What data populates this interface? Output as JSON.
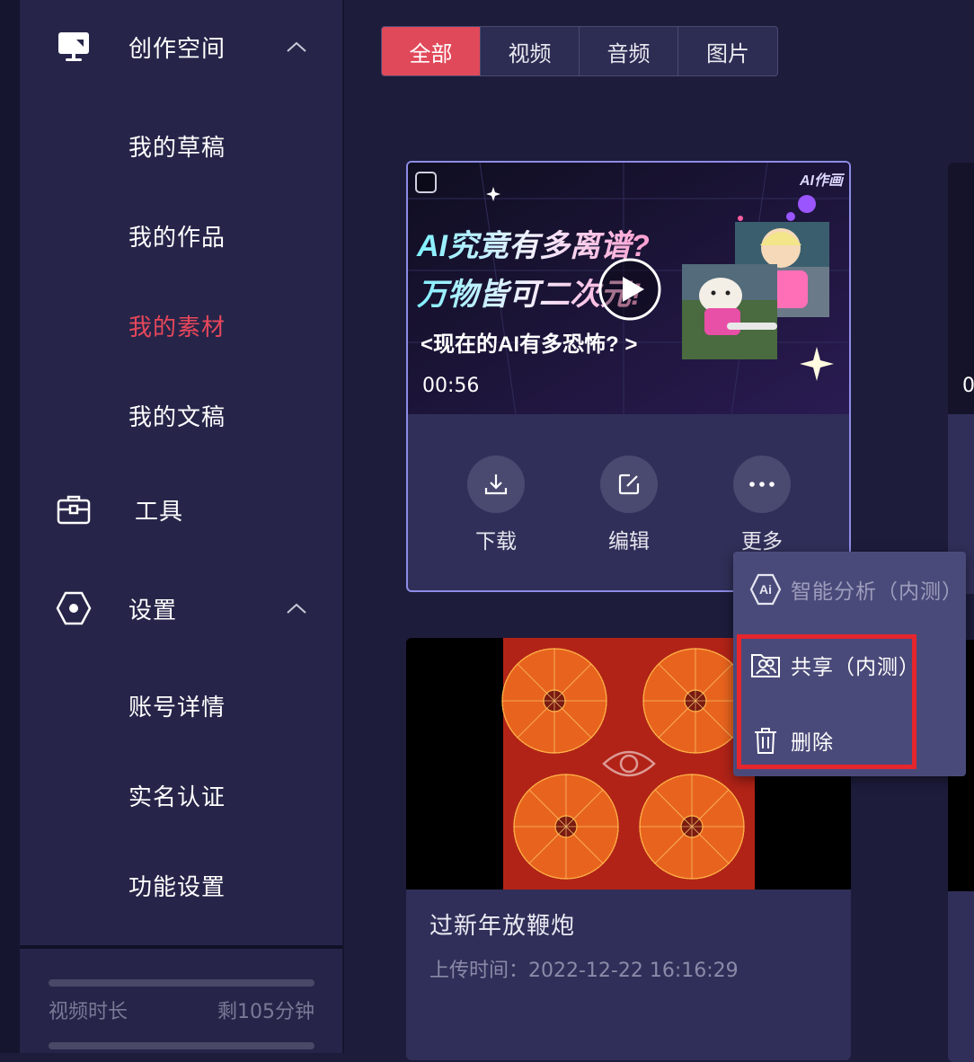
{
  "sidebar": {
    "creation_space": "创作空间",
    "my_drafts": "我的草稿",
    "my_works": "我的作品",
    "my_materials": "我的素材",
    "my_documents": "我的文稿",
    "tools": "工具",
    "settings": "设置",
    "account_details": "账号详情",
    "real_name_auth": "实名认证",
    "feature_settings": "功能设置",
    "quota_label": "视频时长",
    "quota_value": "剩105分钟",
    "accent_color": "#e8475b"
  },
  "filter_tabs": [
    "全部",
    "视频",
    "音频",
    "图片"
  ],
  "active_tab_index": 0,
  "card1": {
    "thumb_line1": "AI究竟有多离谱?",
    "thumb_line2": "万物皆可二次元!",
    "thumb_line3": "<现在的AI有多恐怖? >",
    "thumb_logo": "AI作画",
    "duration": "00:56",
    "actions": [
      "下载",
      "编辑",
      "更多"
    ]
  },
  "card2": {
    "title": "过新年放鞭炮",
    "upload_time": "上传时间：2022-12-22 16:16:29"
  },
  "right_card_partial": "0",
  "more_menu": {
    "items": [
      "智能分析（内测）",
      "共享（内测）",
      "删除"
    ]
  }
}
